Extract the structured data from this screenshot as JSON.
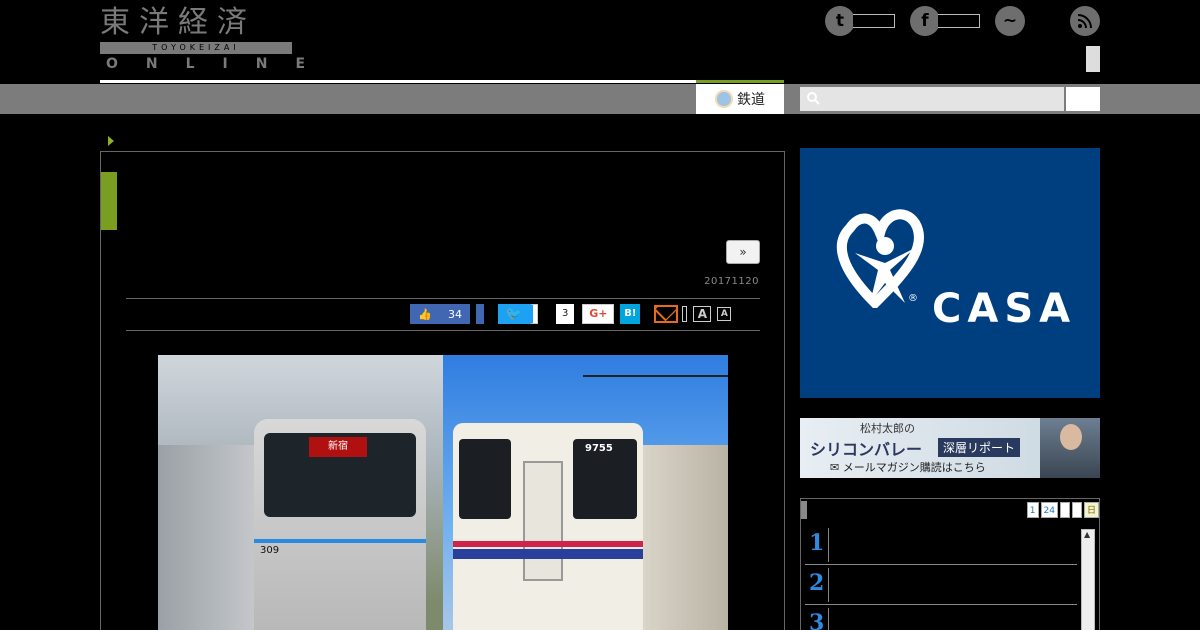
{
  "header": {
    "logo_main": "東洋経済",
    "logo_band": "TOYOKEIZAI",
    "logo_online": "ONLINE",
    "social": [
      {
        "icon": "twitter-icon",
        "glyph": "t"
      },
      {
        "icon": "facebook-icon",
        "glyph": "f"
      },
      {
        "icon": "messenger-icon",
        "glyph": "~"
      }
    ],
    "rss_icon": "rss-icon"
  },
  "nav": {
    "active_tab": "鉄道",
    "search_placeholder": ""
  },
  "article": {
    "next_label": "»",
    "date": "20171120",
    "share": {
      "like_count": "34",
      "share_count": "3",
      "gplus_label": "G+",
      "hatena_label": "B!",
      "font_large": "A",
      "font_small": "A"
    },
    "photo": {
      "left_dest": "新宿",
      "left_number": "309",
      "right_number": "9755"
    }
  },
  "sidebar": {
    "ad": {
      "brand": "CASA",
      "reg": "®"
    },
    "banner": {
      "line1": "松村太郎の",
      "title": "シリコンバレー",
      "tag": "深層リポート",
      "cta": "メールマガジン購読はこちら"
    },
    "ranking": {
      "tabs": [
        "1",
        "24",
        "",
        "",
        "日"
      ],
      "items": [
        "1",
        "2",
        "3"
      ]
    }
  },
  "colors": {
    "accent_green": "#7a9e20",
    "nav_gray": "#7c7c7c",
    "casa_blue": "#003f7f"
  }
}
